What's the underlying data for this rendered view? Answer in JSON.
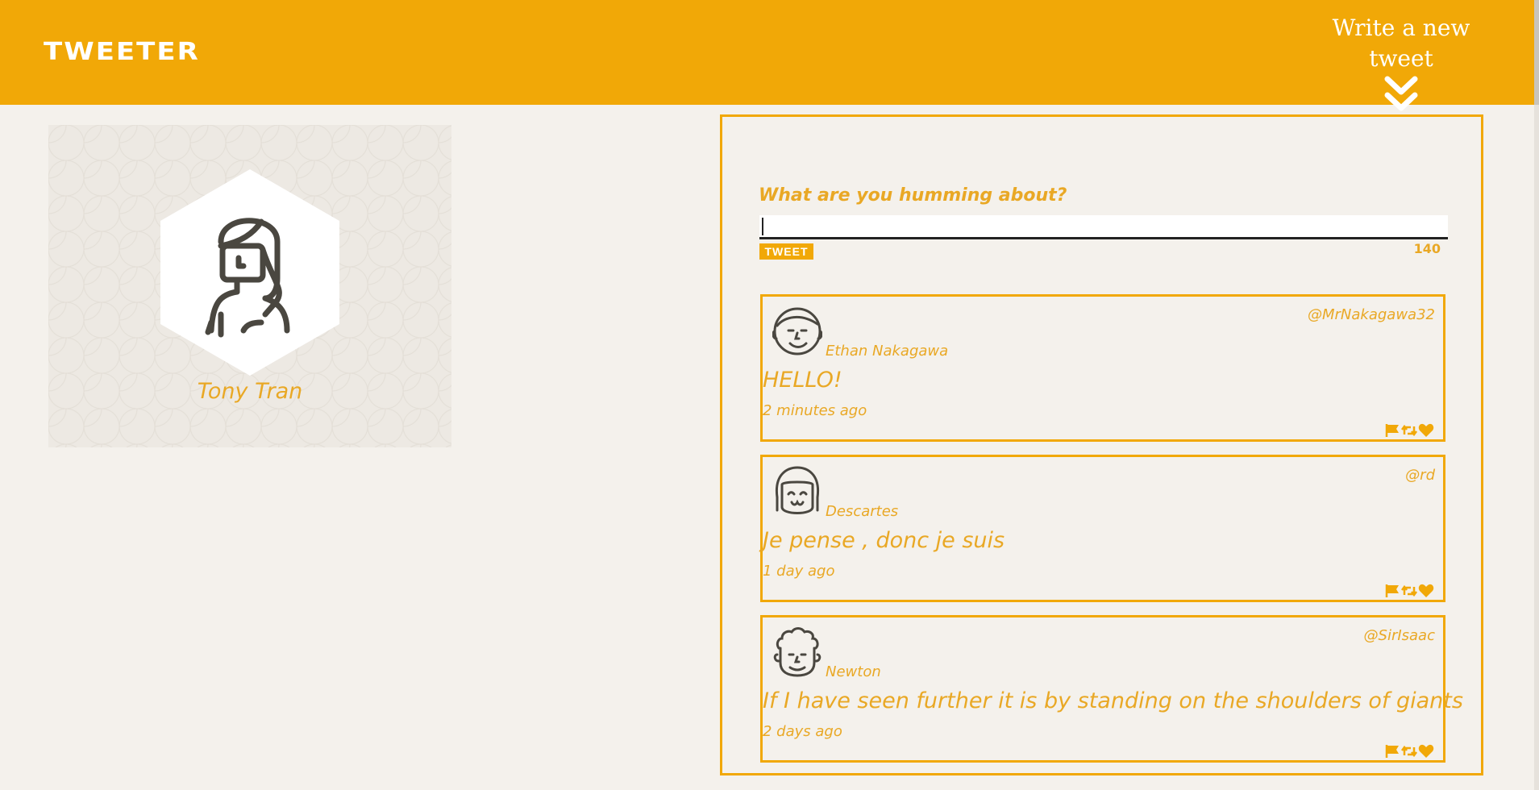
{
  "header": {
    "brand": "TWEETER",
    "compose_toggle_label": "Write a new tweet",
    "compose_toggle_icon": "double-chevron-down-icon"
  },
  "profile": {
    "name": "Tony Tran",
    "avatar_icon": "woman-avatar-icon"
  },
  "compose": {
    "label": "What are you humming about?",
    "input_value": "",
    "button_label": "TWEET",
    "counter": "140"
  },
  "tweets": [
    {
      "handle": "@MrNakagawa32",
      "name": "Ethan Nakagawa",
      "content": "HELLO!",
      "time": "2 minutes ago",
      "avatar_icon": "man-avatar-icon"
    },
    {
      "handle": "@rd",
      "name": "Descartes",
      "content": "Je pense , donc je suis",
      "time": "1 day ago",
      "avatar_icon": "bob-hair-avatar-icon"
    },
    {
      "handle": "@SirIsaac",
      "name": "Newton",
      "content": "If I have seen further it is by standing on the shoulders of giants",
      "time": "2 days ago",
      "avatar_icon": "curly-hair-avatar-icon"
    }
  ],
  "colors": {
    "accent": "#f1a807",
    "text_accent": "#e9a825",
    "background": "#f4f1ec"
  }
}
